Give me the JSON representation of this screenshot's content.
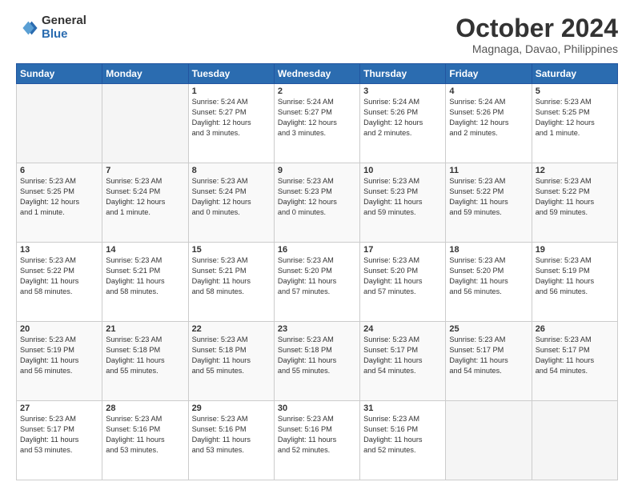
{
  "header": {
    "logo_general": "General",
    "logo_blue": "Blue",
    "month_title": "October 2024",
    "location": "Magnaga, Davao, Philippines"
  },
  "weekdays": [
    "Sunday",
    "Monday",
    "Tuesday",
    "Wednesday",
    "Thursday",
    "Friday",
    "Saturday"
  ],
  "weeks": [
    [
      {
        "day": "",
        "info": ""
      },
      {
        "day": "",
        "info": ""
      },
      {
        "day": "1",
        "info": "Sunrise: 5:24 AM\nSunset: 5:27 PM\nDaylight: 12 hours\nand 3 minutes."
      },
      {
        "day": "2",
        "info": "Sunrise: 5:24 AM\nSunset: 5:27 PM\nDaylight: 12 hours\nand 3 minutes."
      },
      {
        "day": "3",
        "info": "Sunrise: 5:24 AM\nSunset: 5:26 PM\nDaylight: 12 hours\nand 2 minutes."
      },
      {
        "day": "4",
        "info": "Sunrise: 5:24 AM\nSunset: 5:26 PM\nDaylight: 12 hours\nand 2 minutes."
      },
      {
        "day": "5",
        "info": "Sunrise: 5:23 AM\nSunset: 5:25 PM\nDaylight: 12 hours\nand 1 minute."
      }
    ],
    [
      {
        "day": "6",
        "info": "Sunrise: 5:23 AM\nSunset: 5:25 PM\nDaylight: 12 hours\nand 1 minute."
      },
      {
        "day": "7",
        "info": "Sunrise: 5:23 AM\nSunset: 5:24 PM\nDaylight: 12 hours\nand 1 minute."
      },
      {
        "day": "8",
        "info": "Sunrise: 5:23 AM\nSunset: 5:24 PM\nDaylight: 12 hours\nand 0 minutes."
      },
      {
        "day": "9",
        "info": "Sunrise: 5:23 AM\nSunset: 5:23 PM\nDaylight: 12 hours\nand 0 minutes."
      },
      {
        "day": "10",
        "info": "Sunrise: 5:23 AM\nSunset: 5:23 PM\nDaylight: 11 hours\nand 59 minutes."
      },
      {
        "day": "11",
        "info": "Sunrise: 5:23 AM\nSunset: 5:22 PM\nDaylight: 11 hours\nand 59 minutes."
      },
      {
        "day": "12",
        "info": "Sunrise: 5:23 AM\nSunset: 5:22 PM\nDaylight: 11 hours\nand 59 minutes."
      }
    ],
    [
      {
        "day": "13",
        "info": "Sunrise: 5:23 AM\nSunset: 5:22 PM\nDaylight: 11 hours\nand 58 minutes."
      },
      {
        "day": "14",
        "info": "Sunrise: 5:23 AM\nSunset: 5:21 PM\nDaylight: 11 hours\nand 58 minutes."
      },
      {
        "day": "15",
        "info": "Sunrise: 5:23 AM\nSunset: 5:21 PM\nDaylight: 11 hours\nand 58 minutes."
      },
      {
        "day": "16",
        "info": "Sunrise: 5:23 AM\nSunset: 5:20 PM\nDaylight: 11 hours\nand 57 minutes."
      },
      {
        "day": "17",
        "info": "Sunrise: 5:23 AM\nSunset: 5:20 PM\nDaylight: 11 hours\nand 57 minutes."
      },
      {
        "day": "18",
        "info": "Sunrise: 5:23 AM\nSunset: 5:20 PM\nDaylight: 11 hours\nand 56 minutes."
      },
      {
        "day": "19",
        "info": "Sunrise: 5:23 AM\nSunset: 5:19 PM\nDaylight: 11 hours\nand 56 minutes."
      }
    ],
    [
      {
        "day": "20",
        "info": "Sunrise: 5:23 AM\nSunset: 5:19 PM\nDaylight: 11 hours\nand 56 minutes."
      },
      {
        "day": "21",
        "info": "Sunrise: 5:23 AM\nSunset: 5:18 PM\nDaylight: 11 hours\nand 55 minutes."
      },
      {
        "day": "22",
        "info": "Sunrise: 5:23 AM\nSunset: 5:18 PM\nDaylight: 11 hours\nand 55 minutes."
      },
      {
        "day": "23",
        "info": "Sunrise: 5:23 AM\nSunset: 5:18 PM\nDaylight: 11 hours\nand 55 minutes."
      },
      {
        "day": "24",
        "info": "Sunrise: 5:23 AM\nSunset: 5:17 PM\nDaylight: 11 hours\nand 54 minutes."
      },
      {
        "day": "25",
        "info": "Sunrise: 5:23 AM\nSunset: 5:17 PM\nDaylight: 11 hours\nand 54 minutes."
      },
      {
        "day": "26",
        "info": "Sunrise: 5:23 AM\nSunset: 5:17 PM\nDaylight: 11 hours\nand 54 minutes."
      }
    ],
    [
      {
        "day": "27",
        "info": "Sunrise: 5:23 AM\nSunset: 5:17 PM\nDaylight: 11 hours\nand 53 minutes."
      },
      {
        "day": "28",
        "info": "Sunrise: 5:23 AM\nSunset: 5:16 PM\nDaylight: 11 hours\nand 53 minutes."
      },
      {
        "day": "29",
        "info": "Sunrise: 5:23 AM\nSunset: 5:16 PM\nDaylight: 11 hours\nand 53 minutes."
      },
      {
        "day": "30",
        "info": "Sunrise: 5:23 AM\nSunset: 5:16 PM\nDaylight: 11 hours\nand 52 minutes."
      },
      {
        "day": "31",
        "info": "Sunrise: 5:23 AM\nSunset: 5:16 PM\nDaylight: 11 hours\nand 52 minutes."
      },
      {
        "day": "",
        "info": ""
      },
      {
        "day": "",
        "info": ""
      }
    ]
  ]
}
